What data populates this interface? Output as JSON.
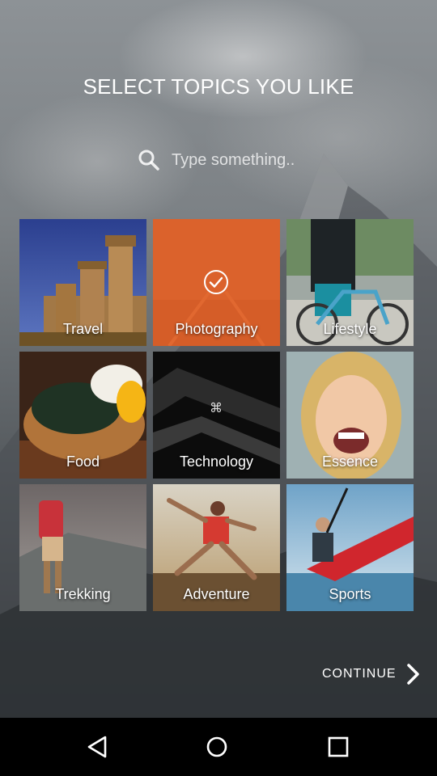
{
  "screen": {
    "title": "SELECT TOPICS YOU LIKE"
  },
  "search": {
    "placeholder": "Type something..",
    "icon": "search-icon"
  },
  "topics": [
    {
      "label": "Travel",
      "selected": false
    },
    {
      "label": "Photography",
      "selected": true
    },
    {
      "label": "Lifestyle",
      "selected": false
    },
    {
      "label": "Food",
      "selected": false
    },
    {
      "label": "Technology",
      "selected": false
    },
    {
      "label": "Essence",
      "selected": false
    },
    {
      "label": "Trekking",
      "selected": false
    },
    {
      "label": "Adventure",
      "selected": false
    },
    {
      "label": "Sports",
      "selected": false
    }
  ],
  "footer": {
    "continue_label": "CONTINUE"
  },
  "nav": {
    "back": "back-icon",
    "home": "home-icon",
    "recents": "recents-icon"
  },
  "colors": {
    "accent": "#f0642a",
    "nav_bg": "#000000",
    "text": "#ffffff"
  }
}
